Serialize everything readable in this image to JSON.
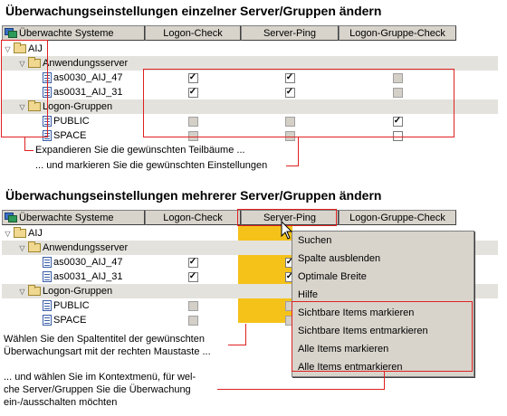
{
  "section1": {
    "heading": "Überwachungseinstellungen einzelner Server/Gruppen ändern",
    "columns": [
      "Überwachte Systeme",
      "Logon-Check",
      "Server-Ping",
      "Logon-Gruppe-Check"
    ],
    "rows": [
      {
        "label": "AIJ",
        "level": 0,
        "type": "root",
        "checks": null
      },
      {
        "label": "Anwendungsserver",
        "level": 1,
        "type": "group",
        "checks": null
      },
      {
        "label": "as0030_AIJ_47",
        "level": 2,
        "type": "item",
        "checks": [
          "on",
          "on",
          "dis"
        ]
      },
      {
        "label": "as0031_AIJ_31",
        "level": 2,
        "type": "item",
        "checks": [
          "on",
          "on",
          "dis"
        ]
      },
      {
        "label": "Logon-Gruppen",
        "level": 1,
        "type": "group",
        "checks": null
      },
      {
        "label": "PUBLIC",
        "level": 2,
        "type": "item",
        "checks": [
          "dis",
          "dis",
          "on"
        ]
      },
      {
        "label": "SPACE",
        "level": 2,
        "type": "item",
        "checks": [
          "dis",
          "dis",
          "off"
        ]
      }
    ],
    "note1": "Expandieren Sie die gewünschten Teilbäume ...",
    "note2": "... und markieren Sie die gewünschten Einstellungen"
  },
  "section2": {
    "heading": "Überwachungseinstellungen mehrerer Server/Gruppen ändern",
    "columns": [
      "Überwachte Systeme",
      "Logon-Check",
      "Server-Ping",
      "Logon-Gruppe-Check"
    ],
    "rows": [
      {
        "label": "AIJ",
        "level": 0,
        "type": "root",
        "checks": null
      },
      {
        "label": "Anwendungsserver",
        "level": 1,
        "type": "group",
        "checks": null
      },
      {
        "label": "as0030_AIJ_47",
        "level": 2,
        "type": "item",
        "checks": [
          "on",
          "on",
          null
        ]
      },
      {
        "label": "as0031_AIJ_31",
        "level": 2,
        "type": "item",
        "checks": [
          "on",
          "on",
          null
        ]
      },
      {
        "label": "Logon-Gruppen",
        "level": 1,
        "type": "group",
        "checks": null
      },
      {
        "label": "PUBLIC",
        "level": 2,
        "type": "item",
        "checks": [
          "dis",
          "dis",
          null
        ]
      },
      {
        "label": "SPACE",
        "level": 2,
        "type": "item",
        "checks": [
          "dis",
          "dis",
          null
        ]
      }
    ],
    "context_menu": {
      "items": [
        "Suchen",
        "Spalte ausblenden",
        "Optimale Breite",
        "Hilfe",
        "Sichtbare Items markieren",
        "Sichtbare Items entmarkieren",
        "Alle Items markieren",
        "Alle Items entmarkieren"
      ]
    },
    "note1_line1": "Wählen Sie den Spaltentitel der gewünschten",
    "note1_line2": "Überwachungsart mit der rechten Maustaste ...",
    "note2_line1": "... und wählen Sie im Kontextmenü, für wel-",
    "note2_line2": "che Server/Gruppen Sie die Überwachung",
    "note2_line3": "ein-/ausschalten möchten"
  },
  "colors": {
    "highlight": "#e02020",
    "column_highlight": "#f5c21a",
    "header_bg": "#d8d4cc"
  },
  "icons": {
    "header": "monitor-systems-icon",
    "folder": "folder-icon",
    "item": "server-document-icon",
    "expand": "triangle-down-icon",
    "check": "checkmark"
  }
}
